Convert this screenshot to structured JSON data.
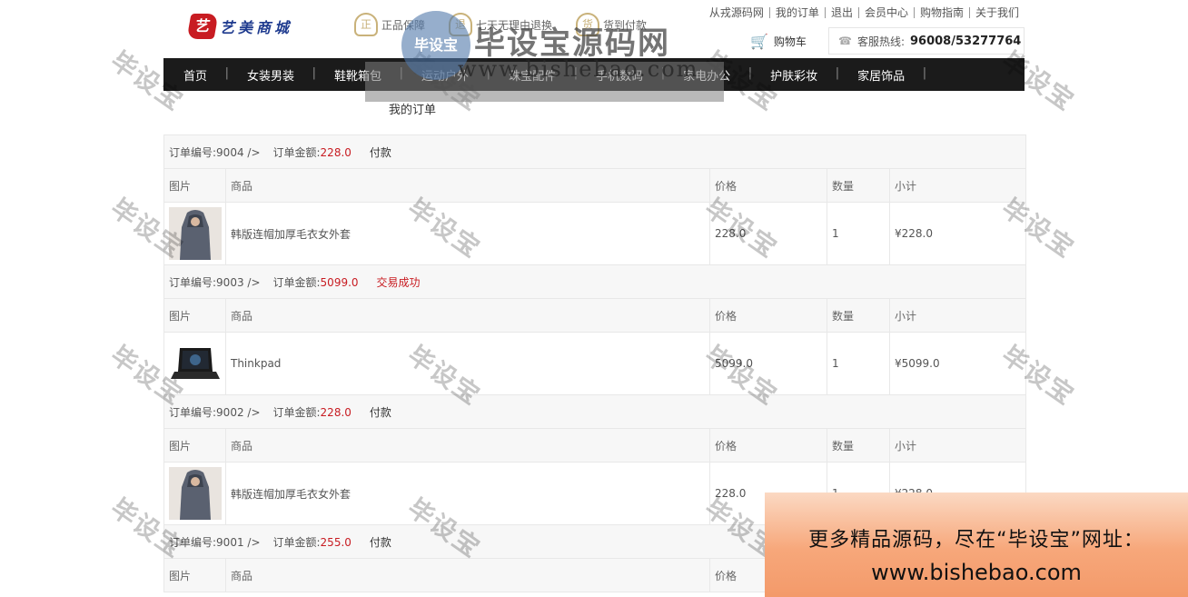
{
  "header": {
    "logo_mark": "艺",
    "logo_text": "艺美商城",
    "guarantees": [
      {
        "icon": "正",
        "label": "正品保障"
      },
      {
        "icon": "退",
        "label": "七天无理由退换"
      },
      {
        "icon": "货",
        "label": "货到付款"
      }
    ],
    "top_links": [
      "从戎源码网",
      "我的订单",
      "退出",
      "会员中心",
      "购物指南",
      "关于我们"
    ],
    "cart_label": "购物车",
    "hotline_label": "客服热线:",
    "hotline_number": "96008/53277764"
  },
  "nav": {
    "items": [
      "首页",
      "女装男装",
      "鞋靴箱包",
      "运动户外",
      "珠宝配件",
      "手机数码",
      "家电办公",
      "护肤彩妆",
      "家居饰品"
    ]
  },
  "section_title": "我的订单",
  "table_headers": {
    "image": "图片",
    "product": "商品",
    "price": "价格",
    "qty": "数量",
    "subtotal": "小计"
  },
  "orders": [
    {
      "no_label": "订单编号:9004 />",
      "amount_label": "订单金额:",
      "amount": "228.0",
      "status": "付款",
      "status_type": "pay",
      "item": {
        "name": "韩版连帽加厚毛衣女外套",
        "price": "228.0",
        "qty": "1",
        "subtotal": "¥228.0",
        "thumb": "sweater"
      }
    },
    {
      "no_label": "订单编号:9003 />",
      "amount_label": "订单金额:",
      "amount": "5099.0",
      "status": "交易成功",
      "status_type": "ok",
      "item": {
        "name": "Thinkpad",
        "price": "5099.0",
        "qty": "1",
        "subtotal": "¥5099.0",
        "thumb": "laptop"
      }
    },
    {
      "no_label": "订单编号:9002 />",
      "amount_label": "订单金额:",
      "amount": "228.0",
      "status": "付款",
      "status_type": "pay",
      "item": {
        "name": "韩版连帽加厚毛衣女外套",
        "price": "228.0",
        "qty": "1",
        "subtotal": "¥228.0",
        "thumb": "sweater"
      }
    },
    {
      "no_label": "订单编号:9001 />",
      "amount_label": "订单金额:",
      "amount": "255.0",
      "status": "付款",
      "status_type": "pay"
    }
  ],
  "watermark": {
    "text": "毕设宝",
    "seal_text": "毕设宝",
    "brand": "毕设宝源码网",
    "url": "www.bishebao.com",
    "promo_line1": "更多精品源码，尽在“毕设宝”网址：",
    "promo_line2": "www.bishebao.com"
  },
  "colors": {
    "accent": "#c81c22",
    "nav_bg": "#1b1b1b"
  }
}
